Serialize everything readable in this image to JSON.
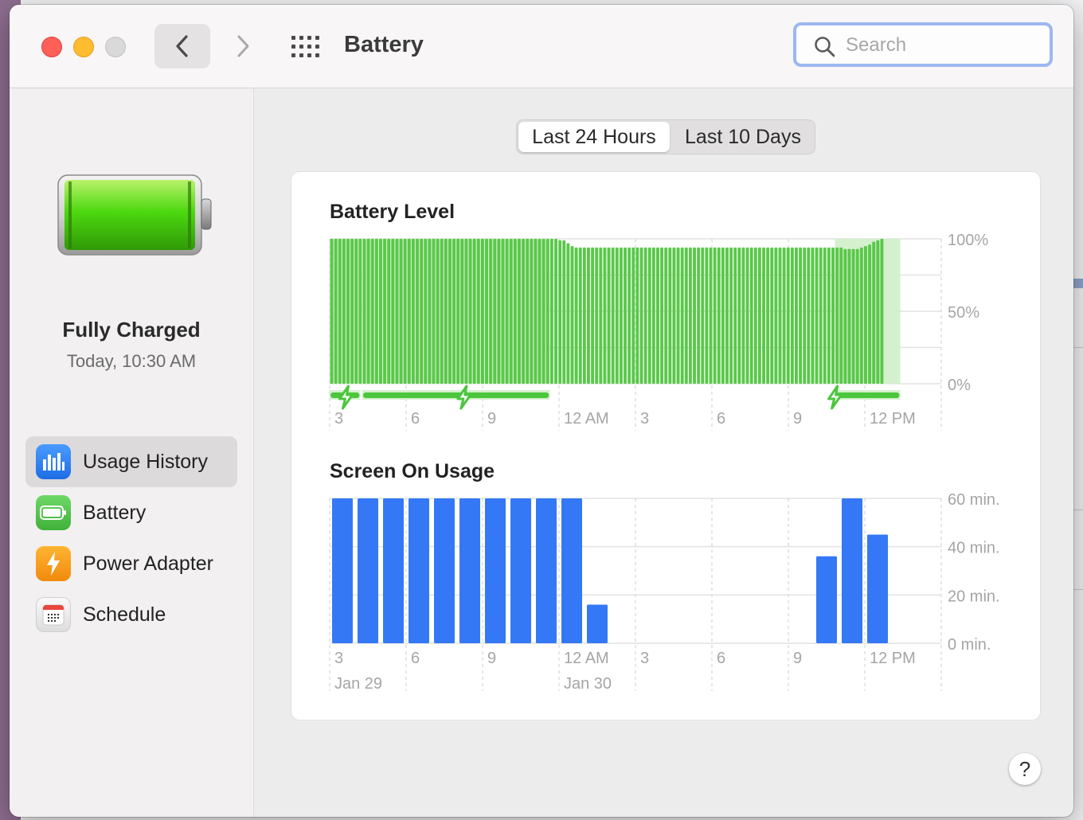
{
  "window": {
    "title": "Battery"
  },
  "search": {
    "placeholder": "Search",
    "value": ""
  },
  "status": {
    "title": "Fully Charged",
    "subtitle": "Today, 10:30 AM"
  },
  "sidebar": {
    "items": [
      {
        "label": "Usage History",
        "icon": "bar-chart-icon",
        "selected": true
      },
      {
        "label": "Battery",
        "icon": "battery-icon",
        "selected": false
      },
      {
        "label": "Power Adapter",
        "icon": "lightning-bolt-icon",
        "selected": false
      },
      {
        "label": "Schedule",
        "icon": "calendar-icon",
        "selected": false
      }
    ]
  },
  "tabs": [
    {
      "label": "Last 24 Hours",
      "selected": true
    },
    {
      "label": "Last 10 Days",
      "selected": false
    }
  ],
  "help": {
    "label": "?"
  },
  "colors": {
    "battery_green": "#5ac84a",
    "charging_band": "#d4f0cd",
    "usage_blue": "#3478f6",
    "accent_search": "#9db7f1"
  },
  "chart_data": [
    {
      "type": "bar",
      "title": "Battery Level",
      "x_ticks": [
        "3",
        "6",
        "9",
        "12 AM",
        "3",
        "6",
        "9",
        "12 PM"
      ],
      "y_ticks": [
        "100%",
        "50%",
        "0%"
      ],
      "ylim": [
        0,
        100
      ],
      "unit": "percent",
      "values": [
        100,
        100,
        100,
        100,
        100,
        100,
        100,
        100,
        100,
        100,
        100,
        100,
        100,
        100,
        100,
        100,
        100,
        100,
        100,
        100,
        100,
        100,
        100,
        100,
        100,
        100,
        100,
        100,
        100,
        100,
        100,
        100,
        100,
        100,
        100,
        100,
        100,
        100,
        100,
        100,
        100,
        100,
        100,
        100,
        100,
        100,
        100,
        100,
        100,
        100,
        100,
        100,
        100,
        100,
        100,
        100,
        99,
        99,
        97,
        95,
        94,
        94,
        94,
        94,
        94,
        94,
        94,
        94,
        94,
        94,
        94,
        94,
        94,
        94,
        94,
        94,
        94,
        94,
        94,
        94,
        94,
        94,
        94,
        94,
        94,
        94,
        94,
        94,
        94,
        94,
        94,
        94,
        94,
        94,
        94,
        94,
        94,
        94,
        94,
        94,
        94,
        94,
        94,
        94,
        94,
        94,
        94,
        94,
        94,
        94,
        94,
        94,
        94,
        94,
        94,
        94,
        94,
        94,
        94,
        94,
        94,
        94,
        94,
        94,
        94,
        94,
        93,
        93,
        93,
        93,
        94,
        95,
        96,
        98,
        99,
        100
      ],
      "charging_periods": [
        [
          0,
          7.5
        ],
        [
          8,
          54
        ],
        [
          124,
          140
        ]
      ],
      "charging_bolts_at": [
        4,
        33,
        124
      ]
    },
    {
      "type": "bar",
      "title": "Screen On Usage",
      "x_ticks": [
        "3",
        "6",
        "9",
        "12 AM",
        "3",
        "6",
        "9",
        "12 PM"
      ],
      "date_labels": [
        "Jan 29",
        "Jan 30"
      ],
      "y_ticks": [
        "60 min.",
        "40 min.",
        "20 min.",
        "0 min."
      ],
      "ylim": [
        0,
        60
      ],
      "unit": "minutes",
      "values": [
        60,
        60,
        60,
        60,
        60,
        60,
        60,
        60,
        60,
        60,
        16,
        0,
        0,
        0,
        0,
        0,
        0,
        0,
        0,
        36,
        60,
        45
      ]
    }
  ]
}
